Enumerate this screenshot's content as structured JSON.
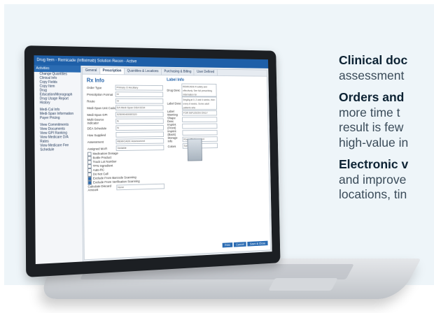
{
  "copy": [
    {
      "heading": "Clinical doc",
      "text": "assessment"
    },
    {
      "heading": "Orders and",
      "lines": [
        "more time t",
        "result is few",
        "high-value in"
      ]
    },
    {
      "heading": "Electronic v",
      "lines": [
        "and improve",
        "locations, tin"
      ]
    }
  ],
  "app": {
    "title": "Drug Item - Remicade (Infliximab) Solution Recon - Active",
    "sidebar_header": "Activities",
    "sidebar_items": [
      "Change Quantities",
      "Clinical Info",
      "Copy Fields",
      "Copy Item",
      "Drug Education/Monograph",
      "Drug Usage Report",
      "History",
      "",
      "Medi-Cal Info",
      "Medi-Span Information",
      "Payer Pricing",
      "",
      "View Commitments",
      "View Documents",
      "View GPI Ranking",
      "View Medicare D/A Rates",
      "View Medicare Fee Schedule"
    ],
    "tabs": [
      "General",
      "Prescription",
      "Quantities & Locations",
      "Purchasing & Billing",
      "User Defined"
    ],
    "rx_title": "Rx Info",
    "label_title": "Label Info",
    "form_rows": [
      {
        "k": "Order Type",
        "v": "Primary   O Ancillary"
      },
      {
        "k": "Prescription Format",
        "v": "IV"
      },
      {
        "k": "Route",
        "v": "IV"
      },
      {
        "k": "Medi-Span Unit Code",
        "v": "EA     Medi-Span DEA  5234"
      },
      {
        "k": "Medi-Span GPI",
        "v": "5250904000E520"
      },
      {
        "k": "Multi-Source Indicator",
        "v": "N"
      },
      {
        "k": "DEA Schedule",
        "v": "N"
      },
      {
        "k": "How Supplied",
        "v": ""
      },
      {
        "k": "Assessment",
        "v": "REMICADE Assessment"
      },
      {
        "k": "Assigned MAR",
        "v": "Variable"
      }
    ],
    "checks": [
      {
        "label": "Medication Dosage",
        "on": false
      },
      {
        "label": "Bottle Product",
        "on": false
      },
      {
        "label": "Track Lot Number",
        "on": false
      },
      {
        "label": "TPN Ingredient",
        "on": false
      },
      {
        "label": "Auto-RC",
        "on": false
      },
      {
        "label": "Do Not Call",
        "on": false
      },
      {
        "label": "Exclude From Barcode Scanning",
        "on": true
      },
      {
        "label": "Exclude From Verification Scanning",
        "on": true
      }
    ],
    "calc_label": "Calculate Discard Amount",
    "calc_value": "None",
    "label_rows": [
      {
        "k": "Drug Desc",
        "v": "REMICADE R safety and effectively. See full prescribing information for"
      },
      {
        "k": "Label Desc",
        "v": "5mg/kg at 0, 2 and 6 weeks, then every 8 weeks. Some adult patients who"
      },
      {
        "k": "Label Warning",
        "v": "FOR INFUSION ONLY"
      },
      {
        "k": "Shape Desc",
        "v": ""
      },
      {
        "k": "Imprint (Front)",
        "v": ""
      },
      {
        "k": "Imprint (Back)",
        "v": ""
      },
      {
        "k": "Storage Info",
        "v": "Room/Refrigerated"
      },
      {
        "k": "Colors",
        "v": "Solid Blue"
      }
    ],
    "buttons": [
      "Print",
      "Cancel",
      "Save & Close"
    ]
  }
}
